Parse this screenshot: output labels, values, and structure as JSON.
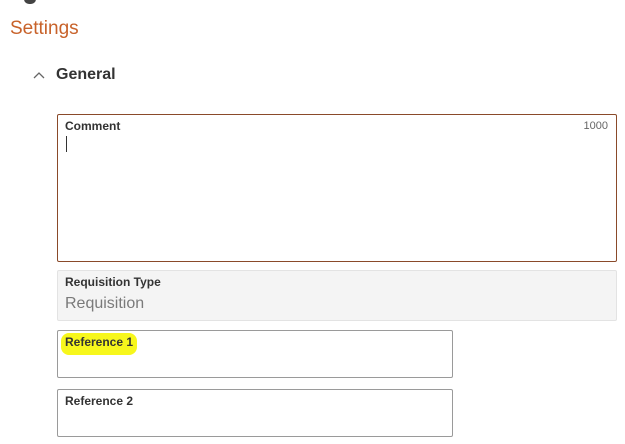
{
  "page": {
    "section_title": "Settings"
  },
  "general_section": {
    "label": "General",
    "expanded": true
  },
  "fields": {
    "comment": {
      "label": "Comment",
      "value": "",
      "max_length": "1000"
    },
    "requisition_type": {
      "label": "Requisition Type",
      "value": "Requisition"
    },
    "reference1": {
      "label": "Reference 1",
      "value": ""
    },
    "reference2": {
      "label": "Reference 2",
      "value": ""
    }
  },
  "colors": {
    "accent": "#c8622a",
    "highlight": "#f7f71c",
    "active_border": "#8a4a2a"
  }
}
